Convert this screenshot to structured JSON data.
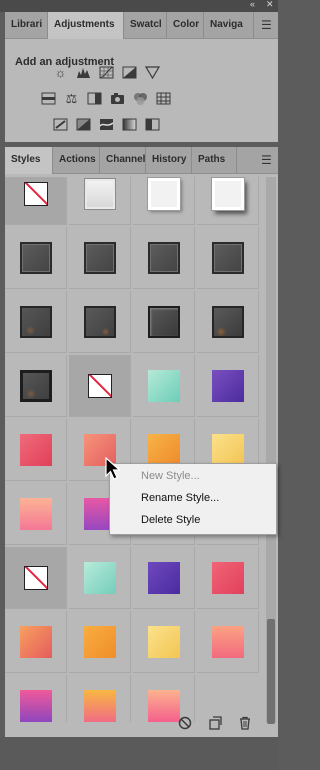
{
  "window": {
    "collapse_icon": "double-chevron-icon",
    "close_icon": "close-icon"
  },
  "top_panel": {
    "tabs": [
      {
        "label": "Librari",
        "active": false
      },
      {
        "label": "Adjustments",
        "active": true
      },
      {
        "label": "Swatcl",
        "active": false
      },
      {
        "label": "Color",
        "active": false
      },
      {
        "label": "Naviga",
        "active": false
      }
    ],
    "heading": "Add an adjustment",
    "adjustment_icons": [
      "brightness-contrast-icon",
      "levels-icon",
      "curves-icon",
      "exposure-icon",
      "vibrance-icon",
      "hue-saturation-icon",
      "color-balance-icon",
      "black-white-icon",
      "photo-filter-icon",
      "channel-mixer-icon",
      "color-lookup-icon",
      "invert-icon",
      "posterize-icon",
      "threshold-icon",
      "gradient-map-icon",
      "selective-color-icon"
    ]
  },
  "styles_panel": {
    "tabs": [
      {
        "label": "Styles",
        "active": true
      },
      {
        "label": "Actions",
        "active": false
      },
      {
        "label": "Channel",
        "active": false
      },
      {
        "label": "History",
        "active": false
      },
      {
        "label": "Paths",
        "active": false
      }
    ],
    "style_swatches": [
      "none",
      "light-bevel",
      "white-frame",
      "white-drop-shadow",
      "dark-bevel",
      "dark-bevel",
      "dark-bevel",
      "dark-bevel",
      "dark-rough",
      "dark-emboss",
      "dark-frame",
      "dark-rough-2",
      "dark-rough-frame",
      "none",
      "mint-watercolor",
      "purple-watercolor",
      "red-pink-watercolor",
      "coral-watercolor",
      "orange-watercolor",
      "yellow-watercolor",
      "peach-pink-watercolor",
      "magenta-purple-watercolor",
      "",
      "",
      "none",
      "mint-watercolor",
      "purple-watercolor",
      "pink-red-watercolor",
      "coral-orange-watercolor",
      "orange-watercolor",
      "yellow-watercolor",
      "salmon-watercolor",
      "pink-purple-watercolor",
      "orange-pink-watercolor",
      "peach-pink-watercolor",
      ""
    ],
    "selected_swatch_index": 13,
    "bottom_icons": [
      "delete-style-clear-icon",
      "new-style-icon",
      "trash-icon"
    ],
    "scroll_position": 0.82
  },
  "context_menu": {
    "items": [
      {
        "label": "New Style...",
        "enabled": false
      },
      {
        "label": "Rename Style...",
        "enabled": true
      },
      {
        "label": "Delete Style",
        "enabled": true
      }
    ]
  },
  "colors": {
    "panel_bg": "#b9b9b9",
    "tab_bar": "#a4a4a4",
    "menu_bg": "#f0f0f0",
    "none_slash": "#e0263f"
  }
}
